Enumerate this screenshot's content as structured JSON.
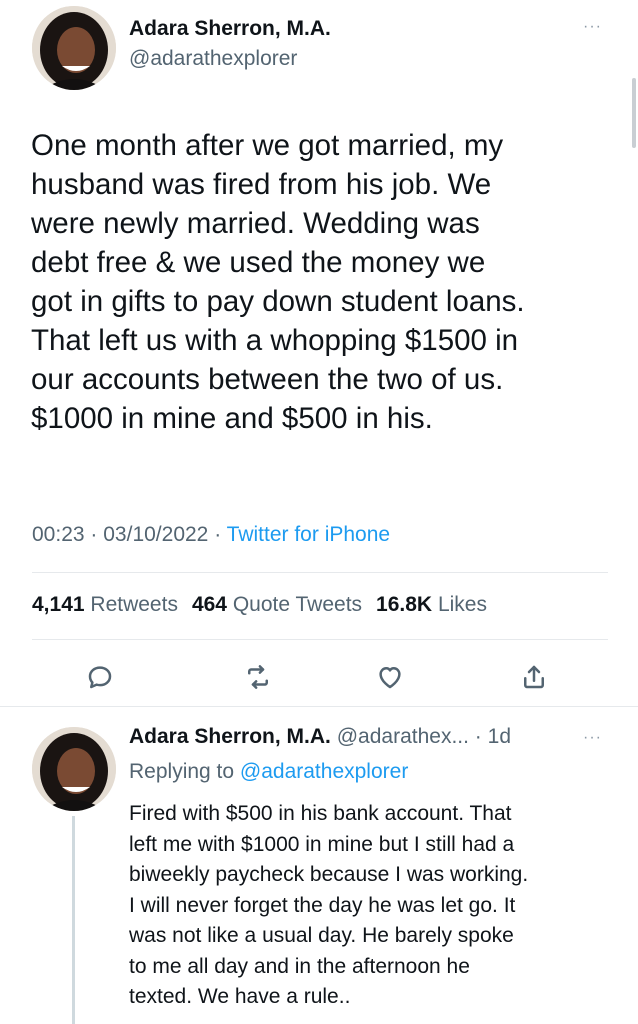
{
  "main_tweet": {
    "author": {
      "display_name": "Adara Sherron, M.A.",
      "handle": "@adarathexplorer"
    },
    "more_label": "···",
    "text_lines": [
      "One month after we got married, my",
      "husband was fired from his job. We",
      "were newly married. Wedding was",
      "debt free & we used the money we",
      "got in gifts to pay down student loans.",
      "That left us with a whopping $1500 in",
      "our accounts between the two of us.",
      "$1000 in mine and $500 in his."
    ],
    "time": "00:23",
    "date": "03/10/2022",
    "source": "Twitter for iPhone",
    "separator": "·",
    "stats": {
      "retweets_count": "4,141",
      "retweets_label": "Retweets",
      "quote_count": "464",
      "quote_label": "Quote Tweets",
      "likes_count": "16.8K",
      "likes_label": "Likes"
    },
    "actions": [
      "reply-icon",
      "retweet-icon",
      "like-icon",
      "share-icon"
    ]
  },
  "reply": {
    "author": {
      "display_name": "Adara Sherron, M.A.",
      "handle": "@adarathex...",
      "time": "1d"
    },
    "more_label": "···",
    "replying_prefix": "Replying to",
    "replying_to": "@adarathexplorer",
    "text_lines": [
      "Fired with $500 in his bank account. That",
      "left me with $1000 in mine but I still had a",
      "biweekly paycheck because I was working.",
      "I will never forget the day he was let go. It",
      "was not like a usual day. He barely spoke",
      "to me all day and in the afternoon he",
      "texted. We have a rule.."
    ]
  },
  "colors": {
    "text": "#0f1419",
    "secondary": "#536471",
    "link": "#1d9bf0",
    "divider": "#e6e9ec"
  }
}
